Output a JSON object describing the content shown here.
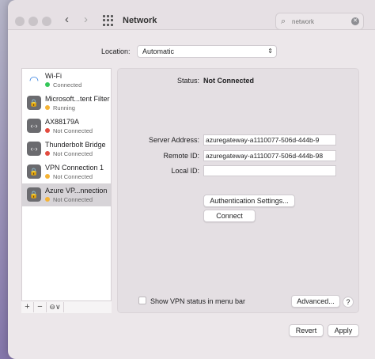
{
  "window": {
    "title": "Network"
  },
  "search": {
    "placeholder": "network"
  },
  "location": {
    "label": "Location:",
    "value": "Automatic"
  },
  "services": [
    {
      "name": "Wi-Fi",
      "status": "Connected",
      "status_color": "#34c759",
      "icon": "wifi-icon"
    },
    {
      "name": "Microsoft...tent Filter",
      "status": "Running",
      "status_color": "#f5b335",
      "icon": "lock-icon"
    },
    {
      "name": "AX88179A",
      "status": "Not Connected",
      "status_color": "#e34b3f",
      "icon": "ethernet-icon"
    },
    {
      "name": "Thunderbolt Bridge",
      "status": "Not Connected",
      "status_color": "#e34b3f",
      "icon": "ethernet-icon"
    },
    {
      "name": "VPN Connection 1",
      "status": "Not Connected",
      "status_color": "#f5b335",
      "icon": "lock-icon"
    },
    {
      "name": "Azure VP...nnection",
      "status": "Not Connected",
      "status_color": "#f5b335",
      "icon": "lock-icon",
      "selected": true
    }
  ],
  "sidebar_buttons": {
    "add": "+",
    "remove": "−",
    "action": "⊖∨"
  },
  "detail": {
    "status_label": "Status:",
    "status_value": "Not Connected",
    "server_label": "Server Address:",
    "server_value": "azuregateway-a1110077-506d-444b-9",
    "remote_label": "Remote ID:",
    "remote_value": "azuregateway-a1110077-506d-444b-98",
    "local_label": "Local ID:",
    "local_value": "",
    "auth_button": "Authentication Settings...",
    "connect_button": "Connect",
    "show_vpn_label": "Show VPN status in menu bar",
    "advanced_button": "Advanced...",
    "help_button": "?"
  },
  "footer": {
    "revert": "Revert",
    "apply": "Apply"
  }
}
